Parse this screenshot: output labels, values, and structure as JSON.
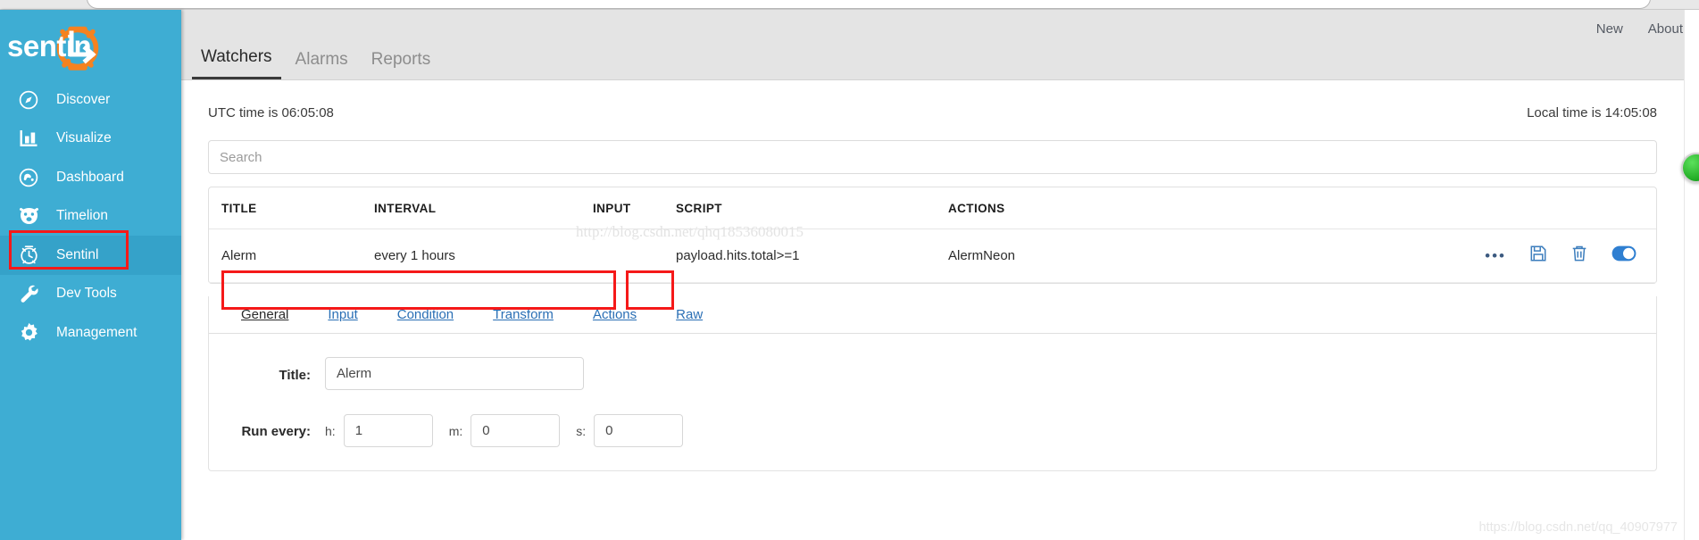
{
  "browser": {
    "omnibox_value": ""
  },
  "sidebar": {
    "brand": "sentinl",
    "brand_color": "#ffffff",
    "accent_color": "#f58220",
    "background_color": "#3eadd3",
    "active_background_color": "#35a2c9",
    "items": [
      {
        "label": "Discover",
        "icon": "compass-icon",
        "active": false
      },
      {
        "label": "Visualize",
        "icon": "bar-chart-icon",
        "active": false
      },
      {
        "label": "Dashboard",
        "icon": "dashboard-icon",
        "active": false
      },
      {
        "label": "Timelion",
        "icon": "timelion-icon",
        "active": false
      },
      {
        "label": "Sentinl",
        "icon": "alarm-clock-icon",
        "active": true
      },
      {
        "label": "Dev Tools",
        "icon": "wrench-icon",
        "active": false
      },
      {
        "label": "Management",
        "icon": "gear-icon",
        "active": false
      }
    ]
  },
  "topbar": {
    "tabs": [
      {
        "label": "Watchers",
        "active": true
      },
      {
        "label": "Alarms",
        "active": false
      },
      {
        "label": "Reports",
        "active": false
      }
    ],
    "right_links": [
      {
        "label": "New"
      },
      {
        "label": "About"
      }
    ]
  },
  "main": {
    "utc_time": "UTC time is 06:05:08",
    "local_time": "Local time is 14:05:08",
    "search": {
      "value": "",
      "placeholder": "Search"
    },
    "table": {
      "columns": [
        "TITLE",
        "INTERVAL",
        "INPUT",
        "SCRIPT",
        "ACTIONS"
      ],
      "rows": [
        {
          "title": "Alerm",
          "interval": "every 1 hours",
          "input": "",
          "script": "payload.hits.total>=1",
          "actions": "AlermNeon",
          "row_icons": [
            {
              "name": "more-options-icon",
              "glyph": "•••"
            },
            {
              "name": "save-icon",
              "glyph": "save"
            },
            {
              "name": "delete-icon",
              "glyph": "trash"
            },
            {
              "name": "enable-toggle",
              "glyph": "toggle",
              "state": "on"
            }
          ]
        }
      ]
    },
    "editor": {
      "tabs": [
        {
          "label": "General",
          "active": true
        },
        {
          "label": "Input",
          "active": false
        },
        {
          "label": "Condition",
          "active": false
        },
        {
          "label": "Transform",
          "active": false
        },
        {
          "label": "Actions",
          "active": false
        },
        {
          "label": "Raw",
          "active": false
        }
      ],
      "form": {
        "title_label": "Title:",
        "title_value": "Alerm",
        "run_every_label": "Run every:",
        "hours_prefix": "h:",
        "hours_value": "1",
        "minutes_prefix": "m:",
        "minutes_value": "0",
        "seconds_prefix": "s:",
        "seconds_value": "0"
      }
    }
  },
  "annotations": {
    "highlight_color": "#f51919",
    "boxes": [
      "sidebar-sentinl",
      "editor-tabs-group",
      "editor-tab-raw"
    ]
  },
  "watermarks": {
    "row": "http://blog.csdn.net/qhq18536080015",
    "bottom": "https://blog.csdn.net/qq_40907977"
  }
}
